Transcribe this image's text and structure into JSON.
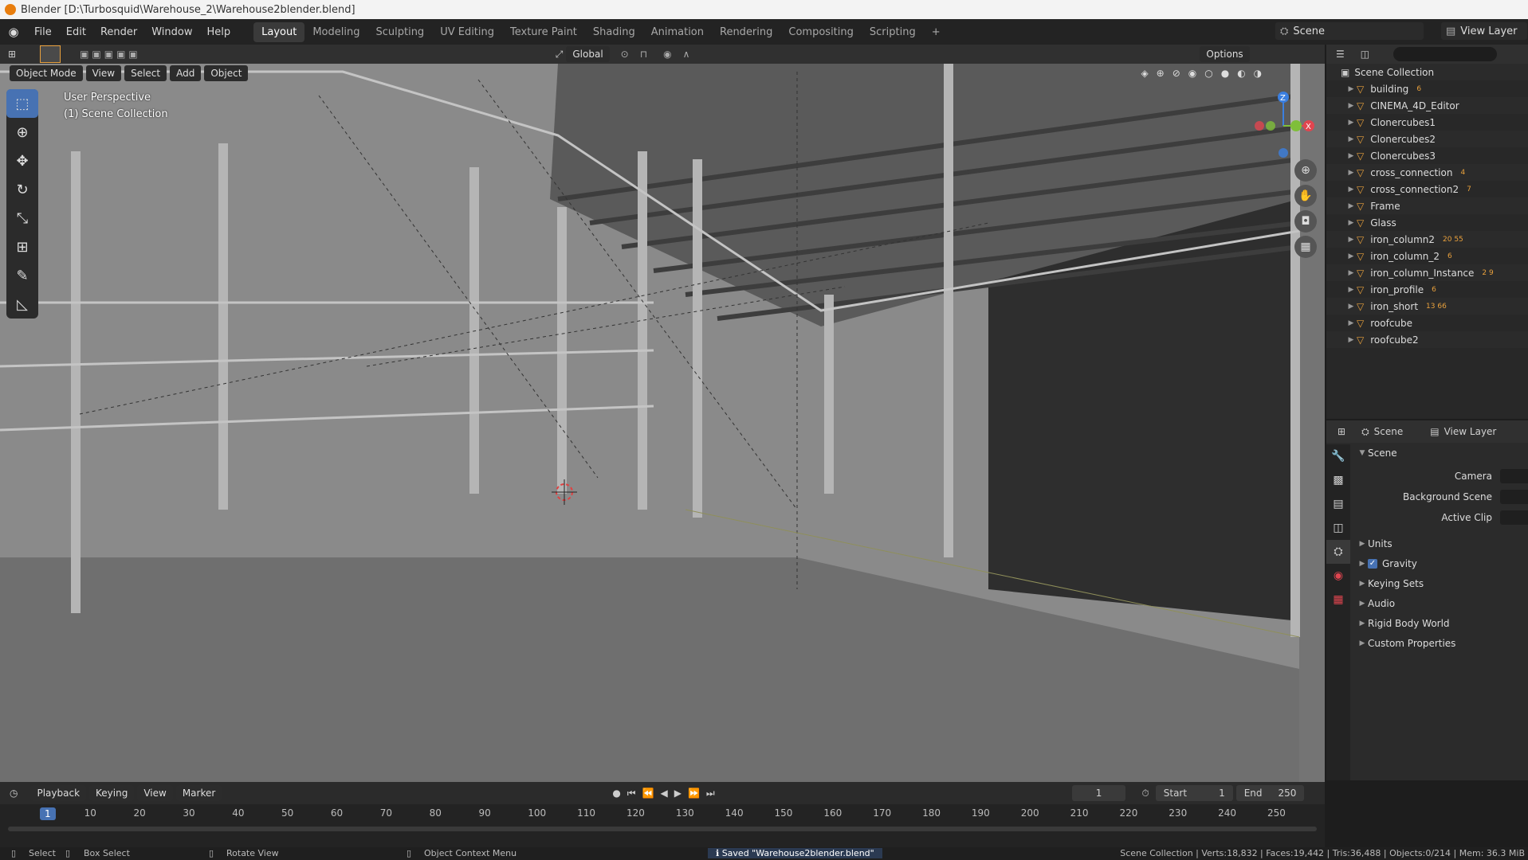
{
  "window": {
    "title": "Blender [D:\\Turbosquid\\Warehouse_2\\Warehouse2blender.blend]"
  },
  "menu": [
    "File",
    "Edit",
    "Render",
    "Window",
    "Help"
  ],
  "workspaces": [
    {
      "label": "Layout",
      "active": true
    },
    {
      "label": "Modeling",
      "active": false
    },
    {
      "label": "Sculpting",
      "active": false
    },
    {
      "label": "UV Editing",
      "active": false
    },
    {
      "label": "Texture Paint",
      "active": false
    },
    {
      "label": "Shading",
      "active": false
    },
    {
      "label": "Animation",
      "active": false
    },
    {
      "label": "Rendering",
      "active": false
    },
    {
      "label": "Compositing",
      "active": false
    },
    {
      "label": "Scripting",
      "active": false
    }
  ],
  "add_workspace": "+",
  "scene_selector": {
    "value": "Scene"
  },
  "view_layer_selector": {
    "value": "View Layer"
  },
  "toolbar": {
    "transform_orientation": "Global",
    "options": "Options"
  },
  "viewport_header": {
    "mode": "Object Mode",
    "view": "View",
    "select": "Select",
    "add": "Add",
    "object": "Object"
  },
  "viewport": {
    "perspective": "User Perspective",
    "collection": "(1) Scene Collection"
  },
  "gizmo": {
    "x": "X",
    "y": "Y",
    "z": "Z"
  },
  "outliner": {
    "root": "Scene Collection",
    "items": [
      {
        "name": "building",
        "badge": "6"
      },
      {
        "name": "CINEMA_4D_Editor",
        "badge": ""
      },
      {
        "name": "Clonercubes1",
        "badge": ""
      },
      {
        "name": "Clonercubes2",
        "badge": ""
      },
      {
        "name": "Clonercubes3",
        "badge": ""
      },
      {
        "name": "cross_connection",
        "badge": "4"
      },
      {
        "name": "cross_connection2",
        "badge": "7"
      },
      {
        "name": "Frame",
        "badge": ""
      },
      {
        "name": "Glass",
        "badge": ""
      },
      {
        "name": "iron_column2",
        "badge": "20 55"
      },
      {
        "name": "iron_column_2",
        "badge": "6"
      },
      {
        "name": "iron_column_Instance",
        "badge": "2 9"
      },
      {
        "name": "iron_profile",
        "badge": "6"
      },
      {
        "name": "iron_short",
        "badge": "13 66"
      },
      {
        "name": "roofcube",
        "badge": ""
      },
      {
        "name": "roofcube2",
        "badge": ""
      }
    ]
  },
  "properties": {
    "header_scene": "Scene",
    "header_view_layer": "View Layer",
    "panel_title": "Scene",
    "camera_label": "Camera",
    "background_scene_label": "Background Scene",
    "active_clip_label": "Active Clip",
    "sections": [
      "Units",
      "Gravity",
      "Keying Sets",
      "Audio",
      "Rigid Body World",
      "Custom Properties"
    ],
    "gravity_checked": true
  },
  "timeline": {
    "playback": "Playback",
    "keying": "Keying",
    "view": "View",
    "marker": "Marker",
    "current_frame": "1",
    "start_label": "Start",
    "start": "1",
    "end_label": "End",
    "end": "250",
    "ticks": [
      "1",
      "10",
      "20",
      "30",
      "40",
      "50",
      "60",
      "70",
      "80",
      "90",
      "100",
      "110",
      "120",
      "130",
      "140",
      "150",
      "160",
      "170",
      "180",
      "190",
      "200",
      "210",
      "220",
      "230",
      "240",
      "250"
    ]
  },
  "statusbar": {
    "select": "Select",
    "box_select": "Box Select",
    "rotate_view": "Rotate View",
    "context_menu": "Object Context Menu",
    "saved_message": "Saved \"Warehouse2blender.blend\"",
    "stats": "Scene Collection | Verts:18,832 | Faces:19,442 | Tris:36,488 | Objects:0/214 | Mem: 36.3 MiB"
  },
  "colors": {
    "accent": "#4772b3",
    "mesh_icon": "#e8a03c",
    "data_icon": "#5fbf6a",
    "gizmo_x": "#e0454f",
    "gizmo_y": "#7fbf3a",
    "gizmo_z": "#3b7fe0"
  }
}
